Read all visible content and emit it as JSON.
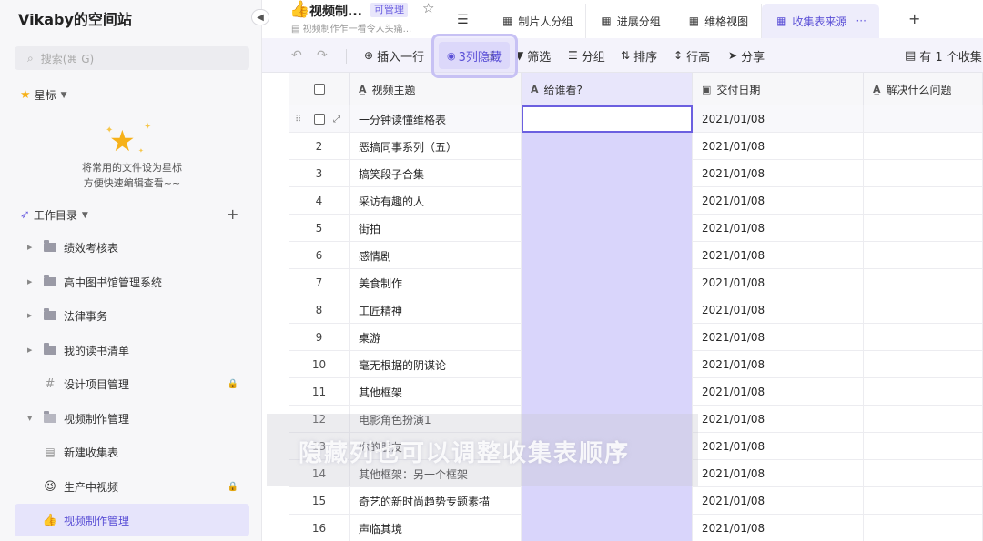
{
  "sidebar": {
    "space_title": "Vikaby的空间站",
    "search_placeholder": "搜索(⌘ G)",
    "favorites_label": "星标",
    "empty_text_line1": "将常用的文件设为星标",
    "empty_text_line2": "方便快速编辑查看~~",
    "workspace_label": "工作目录",
    "items": [
      {
        "label": "绩效考核表"
      },
      {
        "label": "高中图书馆管理系统"
      },
      {
        "label": "法律事务"
      },
      {
        "label": "我的读书清单"
      },
      {
        "label": "设计项目管理"
      },
      {
        "label": "视频制作管理"
      },
      {
        "label": "新建收集表"
      },
      {
        "label": "生产中视频"
      },
      {
        "label": "视频制作管理"
      }
    ]
  },
  "header": {
    "emoji": "👍",
    "title": "视频制...",
    "permission": "可管理",
    "description": "视频制作乍一看令人头痛..."
  },
  "view_tabs": [
    {
      "label": "制片人分组"
    },
    {
      "label": "进展分组"
    },
    {
      "label": "维格视图"
    },
    {
      "label": "收集表来源",
      "more": "···"
    }
  ],
  "toolbar": {
    "undo": "↶",
    "redo": "↷",
    "insert_row": "插入一行",
    "hidden_cols": "3列隐藏",
    "filter": "筛选",
    "group": "分组",
    "sort": "排序",
    "row_height": "行高",
    "share": "分享",
    "right_info": "有 1 个收集"
  },
  "table": {
    "columns": [
      "视频主题",
      "给谁看?",
      "交付日期",
      "解决什么问题"
    ],
    "rows": [
      {
        "num": "",
        "name": "一分钟读懂维格表",
        "date": "2021/01/08"
      },
      {
        "num": "2",
        "name": "恶搞同事系列（五）",
        "date": "2021/01/08"
      },
      {
        "num": "3",
        "name": "搞笑段子合集",
        "date": "2021/01/08"
      },
      {
        "num": "4",
        "name": "采访有趣的人",
        "date": "2021/01/08"
      },
      {
        "num": "5",
        "name": "街拍",
        "date": "2021/01/08"
      },
      {
        "num": "6",
        "name": "感情剧",
        "date": "2021/01/08"
      },
      {
        "num": "7",
        "name": "美食制作",
        "date": "2021/01/08"
      },
      {
        "num": "8",
        "name": "工匠精神",
        "date": "2021/01/08"
      },
      {
        "num": "9",
        "name": "桌游",
        "date": "2021/01/08"
      },
      {
        "num": "10",
        "name": "毫无根据的阴谋论",
        "date": "2021/01/08"
      },
      {
        "num": "11",
        "name": "其他框架",
        "date": "2021/01/08"
      },
      {
        "num": "12",
        "name": "电影角色扮演1",
        "date": "2021/01/08"
      },
      {
        "num": "13",
        "name": "你的朋友",
        "date": "2021/01/08"
      },
      {
        "num": "14",
        "name": "其他框架：另一个框架",
        "date": "2021/01/08"
      },
      {
        "num": "15",
        "name": "奇艺的新时尚趋势专题素描",
        "date": "2021/01/08"
      },
      {
        "num": "16",
        "name": "声临其境",
        "date": "2021/01/08"
      }
    ]
  },
  "caption": "隐藏列也可以调整收集表顺序",
  "colors": {
    "accent": "#6b5fe0",
    "selected_col": "#d9d5fb",
    "active_bg": "#e6e4fb"
  }
}
